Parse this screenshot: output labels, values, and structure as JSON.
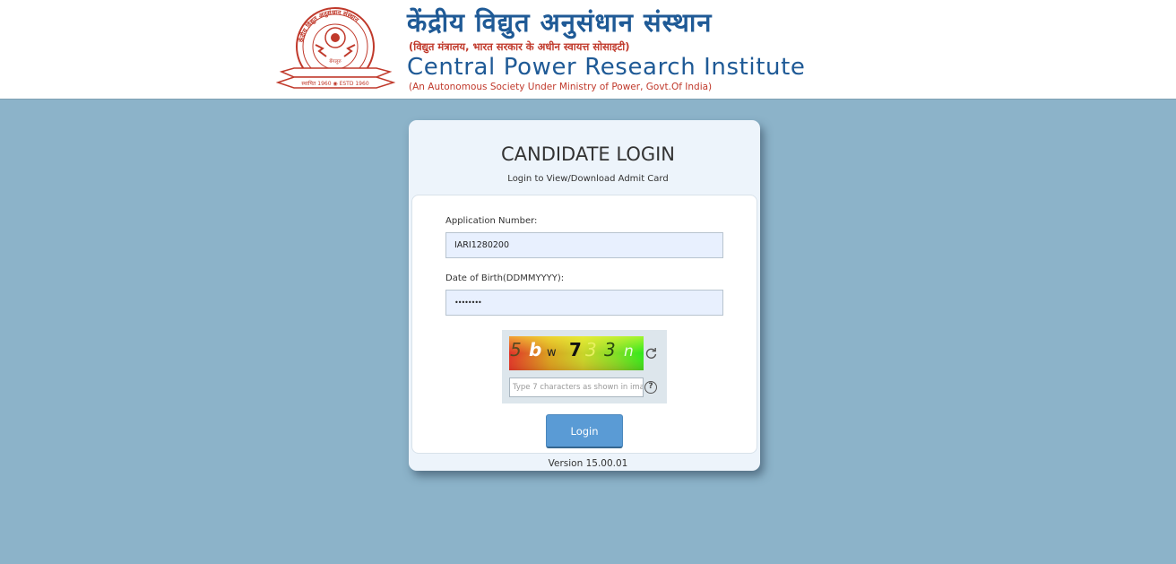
{
  "header": {
    "hindi_title": "केंद्रीय विद्युत अनुसंधान संस्थान",
    "hindi_subtitle": "(विद्युत मंत्रालय, भारत सरकार के अधीन स्वायत्त सोसाइटी)",
    "english_title": "Central Power Research Institute",
    "english_subtitle": "(An Autonomous Society Under Ministry of  Power, Govt.Of India)",
    "logo_ring_text": "केंद्रीय विद्युत अनुसंधान संस्थान",
    "logo_banner_text": "स्थापित 1960 ◉ ESTD 1960",
    "logo_center_text": "बेंगलुरु",
    "accent": "#1f5a96",
    "secondary": "#c0392b"
  },
  "card": {
    "title": "CANDIDATE LOGIN",
    "subtitle": "Login to View/Download Admit Card"
  },
  "form": {
    "application_label": "Application Number:",
    "application_value": "IARI1280200",
    "dob_label": "Date of Birth(DDMMYYYY):",
    "dob_value": "••••••••",
    "captcha_chars": [
      "5",
      "b",
      "w",
      "7",
      "3",
      "3",
      "n"
    ],
    "captcha_placeholder": "Type 7 characters as shown in image",
    "help_symbol": "?",
    "login_label": "Login"
  },
  "footer": {
    "version": "Version 15.00.01"
  },
  "icons": {
    "refresh": "refresh-icon",
    "help": "help-icon"
  }
}
